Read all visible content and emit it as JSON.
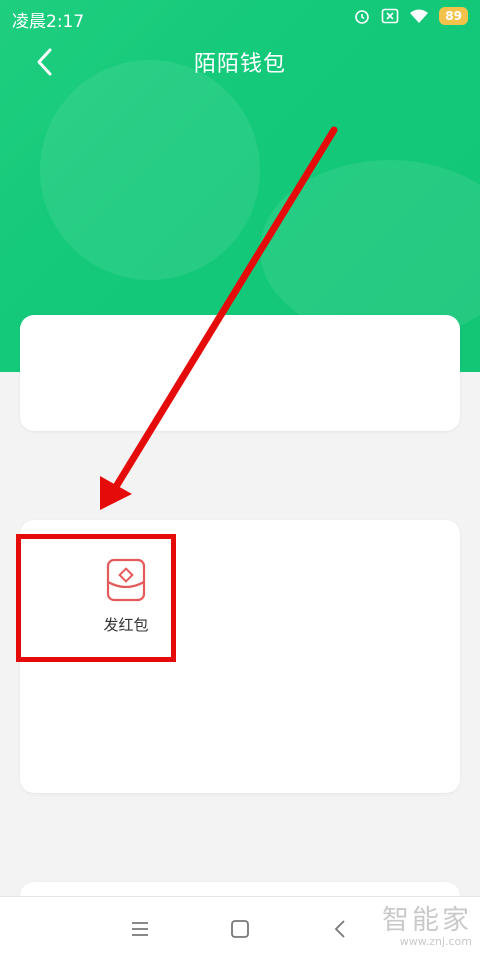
{
  "status_bar": {
    "time": "凌晨2:17",
    "battery": "89",
    "icons": [
      "alarm-icon",
      "sim-x-icon",
      "wifi-icon",
      "battery-icon"
    ]
  },
  "header": {
    "title": "陌陌钱包",
    "back_icon": "chevron-left-icon",
    "color": "#14c97a"
  },
  "actions": [
    {
      "label": "发红包",
      "icon": "red-packet-icon",
      "color": "#e55a5a"
    }
  ],
  "annotation": {
    "color": "#e50b0b"
  },
  "nav_bar": {
    "icons": [
      "menu-icon",
      "home-square-icon",
      "back-triangle-icon"
    ]
  },
  "watermark": {
    "logo": "智能家",
    "url": "www.znj.com"
  }
}
